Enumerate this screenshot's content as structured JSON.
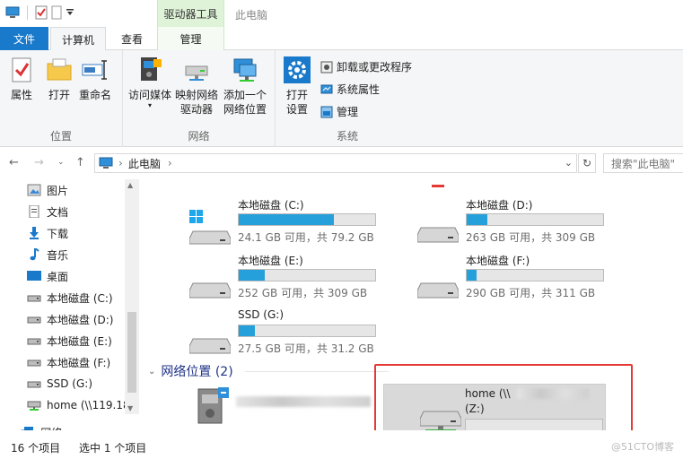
{
  "window": {
    "title": "此电脑",
    "context_tab_title": "驱动器工具"
  },
  "tabs": {
    "file": "文件",
    "computer": "计算机",
    "view": "查看",
    "manage": "管理"
  },
  "ribbon": {
    "groups": [
      {
        "label": "位置",
        "buttons": [
          "属性",
          "打开",
          "重命名"
        ]
      },
      {
        "label": "网络",
        "buttons": [
          "访问媒体",
          "映射网络\n驱动器",
          "添加一个\n网络位置"
        ]
      },
      {
        "label": "系统",
        "buttons": [
          "打开\n设置"
        ],
        "small_buttons": [
          "卸载或更改程序",
          "系统属性",
          "管理"
        ]
      }
    ]
  },
  "address": {
    "path": "此电脑",
    "search_placeholder": "搜索\"此电脑\""
  },
  "sidebar": {
    "items": [
      {
        "label": "图片",
        "icon": "pictures-icon"
      },
      {
        "label": "文档",
        "icon": "documents-icon"
      },
      {
        "label": "下载",
        "icon": "downloads-icon"
      },
      {
        "label": "音乐",
        "icon": "music-icon"
      },
      {
        "label": "桌面",
        "icon": "desktop-icon"
      },
      {
        "label": "本地磁盘 (C:)",
        "icon": "drive-icon"
      },
      {
        "label": "本地磁盘 (D:)",
        "icon": "drive-icon"
      },
      {
        "label": "本地磁盘 (E:)",
        "icon": "drive-icon"
      },
      {
        "label": "本地磁盘 (F:)",
        "icon": "drive-icon"
      },
      {
        "label": "SSD (G:)",
        "icon": "drive-icon"
      },
      {
        "label": "home (\\\\119.18",
        "icon": "network-drive-icon"
      },
      {
        "label": "网络",
        "icon": "network-icon"
      }
    ]
  },
  "drives": [
    {
      "name": "本地磁盘 (C:)",
      "free": "24.1 GB 可用，共 79.2 GB",
      "used_fraction": 0.7,
      "icon": "windows-drive-icon"
    },
    {
      "name": "本地磁盘 (D:)",
      "free": "263 GB 可用，共 309 GB",
      "used_fraction": 0.15,
      "icon": "drive-icon"
    },
    {
      "name": "本地磁盘 (E:)",
      "free": "252 GB 可用，共 309 GB",
      "used_fraction": 0.19,
      "icon": "drive-icon"
    },
    {
      "name": "本地磁盘 (F:)",
      "free": "290 GB 可用，共 311 GB",
      "used_fraction": 0.07,
      "icon": "drive-icon"
    },
    {
      "name": "SSD (G:)",
      "free": "27.5 GB 可用，共 31.2 GB",
      "used_fraction": 0.12,
      "icon": "drive-icon"
    }
  ],
  "network_group": {
    "header": "网络位置 (2)",
    "selected_drive": {
      "name_line1": "home (\\\\",
      "name_line2": "(Z:)"
    }
  },
  "status": {
    "count": "16 个项目",
    "selected": "选中 1 个项目",
    "watermark": "@51CTO博客"
  },
  "colors": {
    "accent": "#1979ca",
    "bar_fill": "#26a0da",
    "highlight_box": "#e53935",
    "context_tab": "#dff3d8"
  }
}
